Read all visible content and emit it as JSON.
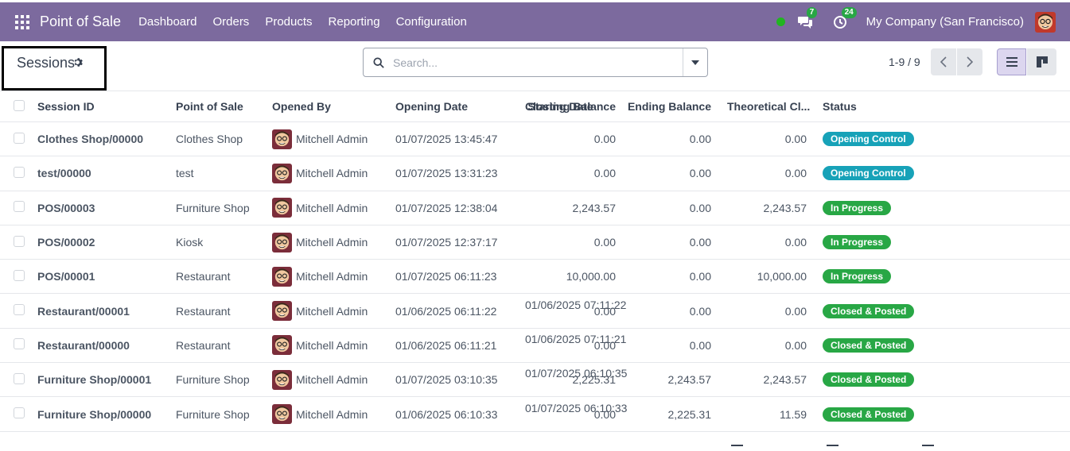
{
  "navbar": {
    "app_name": "Point of Sale",
    "menu": [
      "Dashboard",
      "Orders",
      "Products",
      "Reporting",
      "Configuration"
    ],
    "messages_count": "7",
    "activities_count": "24",
    "company": "My Company (San Francisco)"
  },
  "control_panel": {
    "title": "Sessions",
    "search_placeholder": "Search...",
    "pager": "1-9 / 9"
  },
  "table": {
    "columns": [
      "Session ID",
      "Point of Sale",
      "Opened By",
      "Opening Date",
      "Closing Date",
      "Starting Balance",
      "Ending Balance",
      "Theoretical Cl...",
      "Status"
    ],
    "rows": [
      {
        "id": "Clothes Shop/00000",
        "pos": "Clothes Shop",
        "user": "Mitchell Admin",
        "opened": "01/07/2025 13:45:47",
        "closed": "",
        "start": "0.00",
        "end": "0.00",
        "theo": "0.00",
        "status": "Opening Control"
      },
      {
        "id": "test/00000",
        "pos": "test",
        "user": "Mitchell Admin",
        "opened": "01/07/2025 13:31:23",
        "closed": "",
        "start": "0.00",
        "end": "0.00",
        "theo": "0.00",
        "status": "Opening Control"
      },
      {
        "id": "POS/00003",
        "pos": "Furniture Shop",
        "user": "Mitchell Admin",
        "opened": "01/07/2025 12:38:04",
        "closed": "",
        "start": "2,243.57",
        "end": "0.00",
        "theo": "2,243.57",
        "status": "In Progress"
      },
      {
        "id": "POS/00002",
        "pos": "Kiosk",
        "user": "Mitchell Admin",
        "opened": "01/07/2025 12:37:17",
        "closed": "",
        "start": "0.00",
        "end": "0.00",
        "theo": "0.00",
        "status": "In Progress"
      },
      {
        "id": "POS/00001",
        "pos": "Restaurant",
        "user": "Mitchell Admin",
        "opened": "01/07/2025 06:11:23",
        "closed": "",
        "start": "10,000.00",
        "end": "0.00",
        "theo": "10,000.00",
        "status": "In Progress"
      },
      {
        "id": "Restaurant/00001",
        "pos": "Restaurant",
        "user": "Mitchell Admin",
        "opened": "01/06/2025 06:11:22",
        "closed": "01/06/2025 07:11:22",
        "start": "0.00",
        "end": "0.00",
        "theo": "0.00",
        "status": "Closed & Posted"
      },
      {
        "id": "Restaurant/00000",
        "pos": "Restaurant",
        "user": "Mitchell Admin",
        "opened": "01/06/2025 06:11:21",
        "closed": "01/06/2025 07:11:21",
        "start": "0.00",
        "end": "0.00",
        "theo": "0.00",
        "status": "Closed & Posted"
      },
      {
        "id": "Furniture Shop/00001",
        "pos": "Furniture Shop",
        "user": "Mitchell Admin",
        "opened": "01/07/2025 03:10:35",
        "closed": "01/07/2025 06:10:35",
        "start": "2,225.31",
        "end": "2,243.57",
        "theo": "2,243.57",
        "status": "Closed & Posted"
      },
      {
        "id": "Furniture Shop/00000",
        "pos": "Furniture Shop",
        "user": "Mitchell Admin",
        "opened": "01/06/2025 06:10:33",
        "closed": "01/07/2025 06:10:33",
        "start": "0.00",
        "end": "2,225.31",
        "theo": "11.59",
        "status": "Closed & Posted"
      }
    ]
  },
  "status_colors": {
    "Opening Control": "#17a2b8",
    "In Progress": "#28a745",
    "Closed & Posted": "#28a745"
  },
  "colors": {
    "navbar": "#7c6a9e",
    "online_dot": "#21b521"
  }
}
